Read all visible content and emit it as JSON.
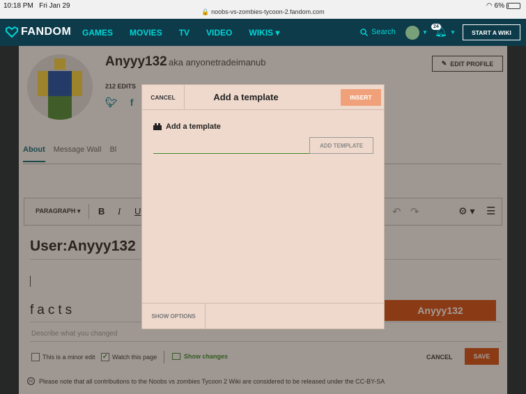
{
  "status_bar": {
    "time": "10:18 PM",
    "date": "Fri Jan 29",
    "url": "noobs-vs-zombies-tycoon-2.fandom.com",
    "battery": "6%",
    "battery_level": 0.06
  },
  "nav": {
    "logo": "FANDOM",
    "links": [
      "GAMES",
      "MOVIES",
      "TV",
      "VIDEO",
      "WIKIS"
    ],
    "search": "Search",
    "notifications": "24",
    "start_wiki": "START A WIKI"
  },
  "profile": {
    "username": "Anyyy132",
    "aka": "aka anyonetradeimanub",
    "edits": "212 EDITS",
    "edit_profile": "EDIT PROFILE"
  },
  "tabs": [
    "About",
    "Message Wall",
    "Bl"
  ],
  "toolbar": {
    "paragraph": "PARAGRAPH",
    "bold": "B",
    "italic": "I",
    "underline": "U"
  },
  "editor": {
    "title": "User:Anyyy132",
    "body_text": "facts",
    "banner": "Anyyy132",
    "summary_placeholder": "Describe what you changed"
  },
  "save_bar": {
    "minor_edit": "This is a minor edit",
    "watch": "Watch this page",
    "show_changes": "Show changes",
    "cancel": "CANCEL",
    "save": "SAVE"
  },
  "license": "Please note that all contributions to the Noobs vs zombies Tycoon 2 Wiki are considered to be released under the CC-BY-SA",
  "dialog": {
    "cancel": "CANCEL",
    "title": "Add a template",
    "insert": "INSERT",
    "section_label": "Add a template",
    "input_value": "",
    "add_button": "ADD TEMPLATE",
    "show_options": "SHOW OPTIONS"
  }
}
